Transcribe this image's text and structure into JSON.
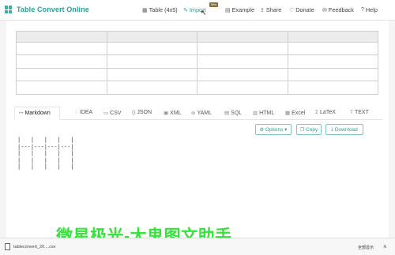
{
  "nav": {
    "brand": "Table Convert Online",
    "items": [
      {
        "icon": "table-icon",
        "glyph": "▦",
        "label": "Table (4x5)"
      },
      {
        "icon": "import-icon",
        "glyph": "✎",
        "label": "Import",
        "badge": "New"
      },
      {
        "icon": "example-icon",
        "glyph": "▤",
        "label": "Example"
      },
      {
        "icon": "share-icon",
        "glyph": "⇪",
        "label": "Share"
      },
      {
        "icon": "donate-icon",
        "glyph": "♡",
        "label": "Donate"
      },
      {
        "icon": "feedback-icon",
        "glyph": "✉",
        "label": "Feedback"
      },
      {
        "icon": "help-icon",
        "glyph": "?",
        "label": "Help"
      }
    ]
  },
  "tabs": [
    {
      "icon": "markdown-icon",
      "glyph": "↦",
      "label": "Markdown"
    },
    {
      "icon": "idea-icon",
      "glyph": "◌",
      "label": "IDEA"
    },
    {
      "icon": "csv-icon",
      "glyph": "▭",
      "label": "CSV"
    },
    {
      "icon": "json-icon",
      "glyph": "{}",
      "label": "JSON"
    },
    {
      "icon": "xml-icon",
      "glyph": "▣",
      "label": "XML"
    },
    {
      "icon": "yaml-icon",
      "glyph": "⊜",
      "label": "YAML"
    },
    {
      "icon": "sql-icon",
      "glyph": "▤",
      "label": "SQL"
    },
    {
      "icon": "html-icon",
      "glyph": "▥",
      "label": "HTML"
    },
    {
      "icon": "excel-icon",
      "glyph": "▦",
      "label": "Excel"
    },
    {
      "icon": "latex-icon",
      "glyph": "Σ",
      "label": "LaTeX"
    },
    {
      "icon": "text-icon",
      "glyph": "T",
      "label": "TEXT"
    }
  ],
  "actions": {
    "options": "Options ▾",
    "copy": "Copy",
    "download": "Download"
  },
  "markdown_output": "|   |   |   |   |\n|---|---|---|---|\n|   |   |   |   |\n|   |   |   |   |\n|   |   |   |   |",
  "watermark": "微星极光-大鬼图文助手",
  "download_bar": {
    "filename": "tableconvert_20....csv",
    "show_all": "全部显示"
  },
  "colors": {
    "brand": "#2aa394",
    "watermark": "#36e33a",
    "button_border": "#7cc8bf"
  }
}
